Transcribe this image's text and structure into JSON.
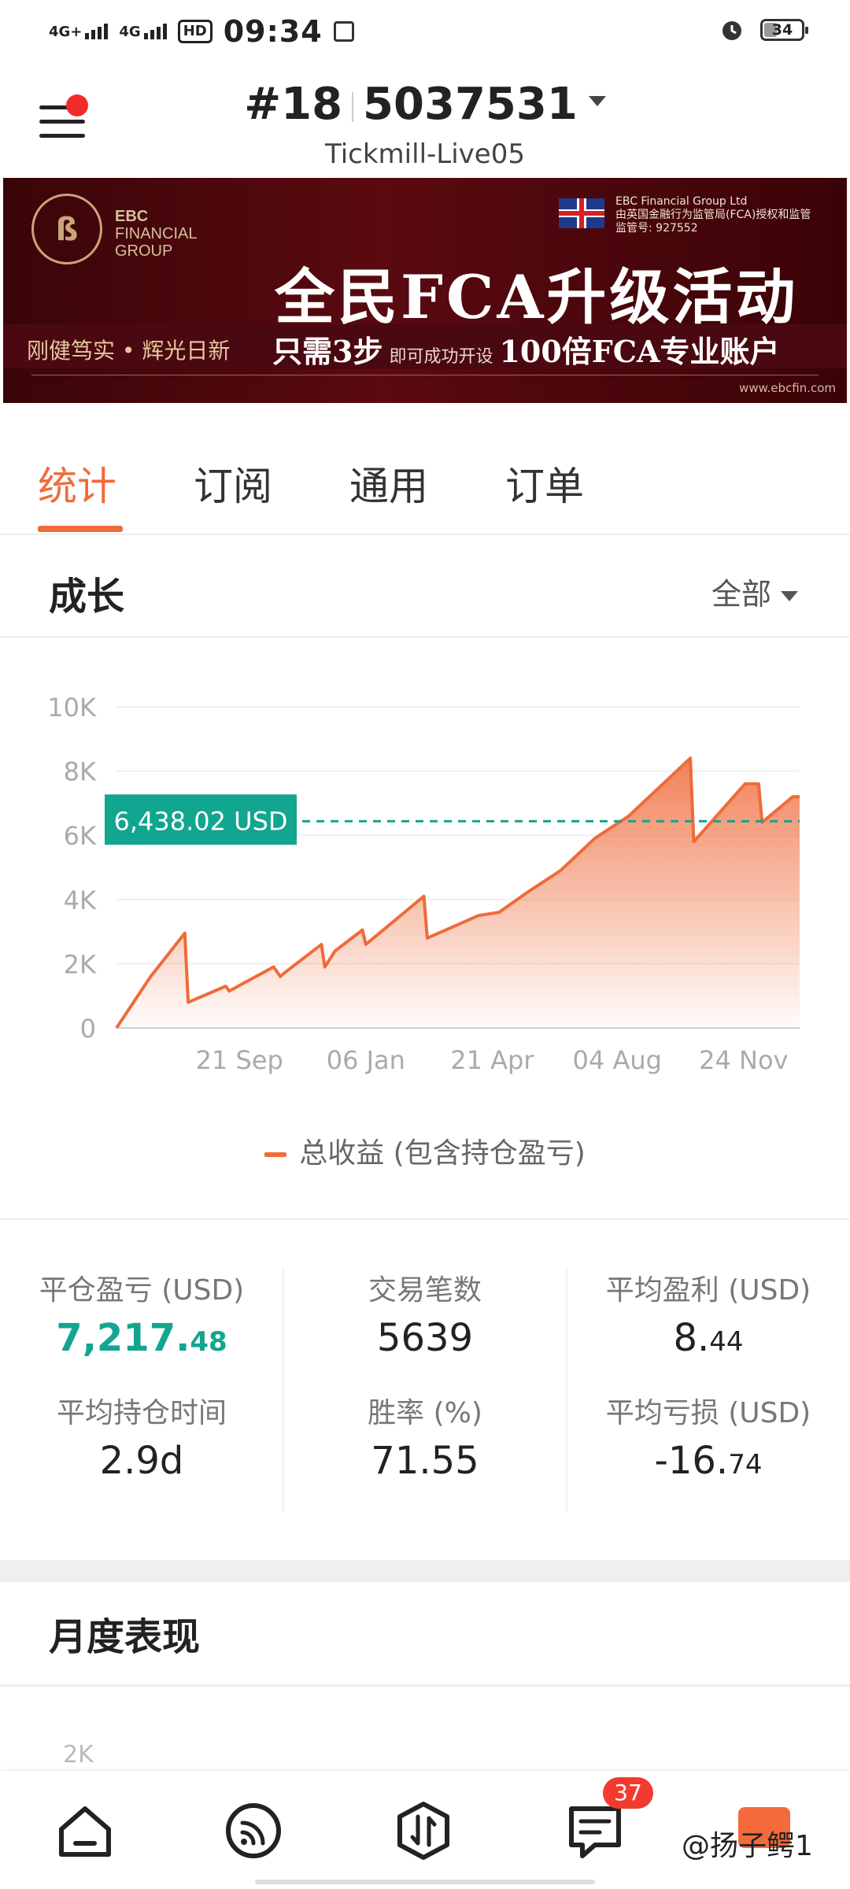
{
  "status_bar": {
    "net1": "4G+",
    "net2": "4G",
    "hd": "HD",
    "time": "09:34",
    "battery": "34"
  },
  "header": {
    "account_prefix": "#18",
    "account_number": "5037531",
    "server": "Tickmill-Live05"
  },
  "banner": {
    "logo_mark": "EBC",
    "logo_line1": "EBC",
    "logo_line2": "FINANCIAL",
    "logo_line3": "GROUP",
    "reg_line1": "EBC Financial Group Ltd",
    "reg_line2": "由英国金融行为监管局(FCA)授权和监管",
    "reg_line3": "监管号: 927552",
    "headline": "全民FCA升级活动",
    "slogan": "刚健笃实 • 辉光日新",
    "sub_main": "只需3步",
    "sub_small": "即可成功开设",
    "sub_end": "100倍FCA专业账户",
    "url": "www.ebcfin.com"
  },
  "tabs": [
    {
      "label": "统计",
      "active": true
    },
    {
      "label": "订阅",
      "active": false
    },
    {
      "label": "通用",
      "active": false
    },
    {
      "label": "订单",
      "active": false
    }
  ],
  "growth": {
    "title": "成长",
    "filter": "全部"
  },
  "chart_data": {
    "type": "area",
    "y_ticks": [
      "10K",
      "8K",
      "6K",
      "4K",
      "2K",
      "0"
    ],
    "x_ticks": [
      "21 Sep",
      "06 Jan",
      "21 Apr",
      "04 Aug",
      "24 Nov"
    ],
    "ylim": [
      0,
      10000
    ],
    "current_value": 6438.02,
    "current_label": "6,438.02 USD",
    "legend": "总收益 (包含持仓盈亏)",
    "color": "#ef6b3a",
    "marker_color": "#12a58f",
    "x": [
      0,
      0.05,
      0.1,
      0.105,
      0.16,
      0.165,
      0.23,
      0.24,
      0.245,
      0.3,
      0.305,
      0.32,
      0.36,
      0.365,
      0.45,
      0.455,
      0.53,
      0.56,
      0.6,
      0.65,
      0.7,
      0.75,
      0.8,
      0.84,
      0.845,
      0.92,
      0.94,
      0.945,
      0.99,
      1.0
    ],
    "values": [
      0,
      1600,
      2950,
      800,
      1300,
      1150,
      1900,
      1600,
      1700,
      2600,
      1900,
      2400,
      3050,
      2600,
      4100,
      2800,
      3500,
      3600,
      4200,
      4900,
      5900,
      6600,
      7600,
      8400,
      5800,
      7600,
      7600,
      6400,
      7200,
      7200
    ]
  },
  "stats": {
    "closed_pl_label": "平仓盈亏 (USD)",
    "closed_pl_int": "7,217.",
    "closed_pl_dec": "48",
    "trades_label": "交易笔数",
    "trades_value": "5639",
    "avg_profit_label": "平均盈利 (USD)",
    "avg_profit_int": "8.",
    "avg_profit_dec": "44",
    "avg_hold_label": "平均持仓时间",
    "avg_hold_value": "2.9d",
    "win_rate_label": "胜率 (%)",
    "win_rate_value": "71.55",
    "avg_loss_label": "平均亏损 (USD)",
    "avg_loss_int": "-16.",
    "avg_loss_dec": "74"
  },
  "monthly": {
    "title": "月度表现",
    "first_tick": "2K"
  },
  "bottom_nav": {
    "badge": "37",
    "watermark": "@扬子鳄1"
  }
}
